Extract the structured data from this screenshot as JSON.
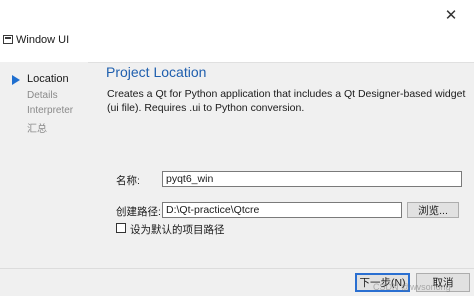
{
  "window": {
    "title": "Window UI",
    "close_glyph": "✕"
  },
  "sidebar": {
    "items": [
      {
        "label": "Location",
        "active": true
      },
      {
        "label": "Details",
        "active": false
      },
      {
        "label": "Interpreter",
        "active": false
      },
      {
        "label": "汇总",
        "active": false
      }
    ]
  },
  "page": {
    "title": "Project Location",
    "description": "Creates a Qt for Python application that includes a Qt Designer-based widget (ui file). Requires .ui to Python conversion."
  },
  "form": {
    "name_label": "名称:",
    "name_value": "pyqt6_win",
    "path_label": "创建路径:",
    "path_value": "D:\\Qt-practice\\Qtcre",
    "browse_label": "浏览...",
    "default_path_label": "设为默认的项目路径",
    "default_path_checked": false
  },
  "footer": {
    "next_label": "下一步(N)",
    "cancel_label": "取消"
  },
  "watermark": "CSDN @wvsonong",
  "colors": {
    "accent": "#1f6fcf",
    "title_blue": "#1f5fae"
  }
}
